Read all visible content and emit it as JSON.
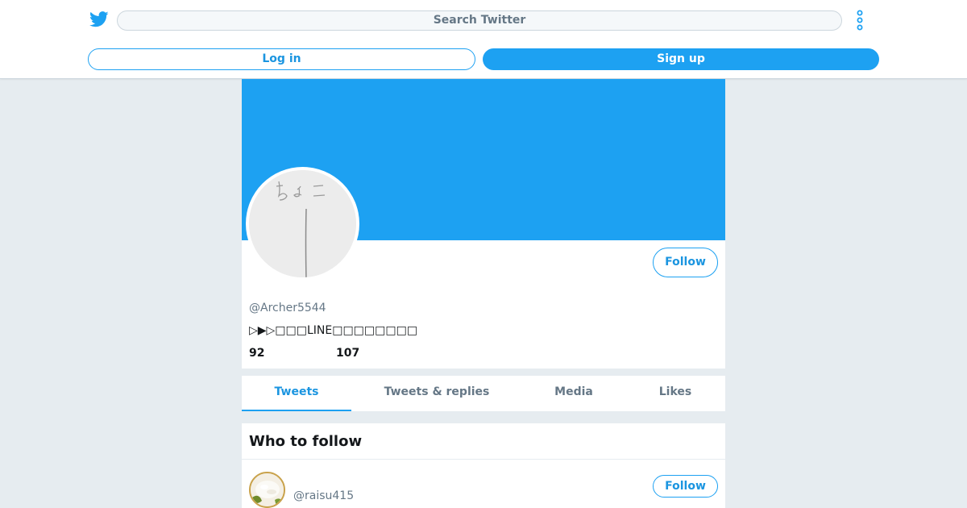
{
  "header": {
    "logo_icon": "twitter-bird-icon",
    "search_placeholder": "Search Twitter",
    "more_icon": "more-vertical-icon",
    "login_label": "Log in",
    "signup_label": "Sign up"
  },
  "profile": {
    "handle": "@Archer5544",
    "bio": "▷▶▷□□□LINE□□□□□□□□",
    "following_count": "92",
    "followers_count": "107",
    "follow_label": "Follow",
    "banner_color": "#1da1f2"
  },
  "tabs": [
    {
      "label": "Tweets",
      "active": true
    },
    {
      "label": "Tweets & replies",
      "active": false
    },
    {
      "label": "Media",
      "active": false
    },
    {
      "label": "Likes",
      "active": false
    }
  ],
  "who_to_follow": {
    "title": "Who to follow",
    "items": [
      {
        "handle": "@raisu415",
        "follow_label": "Follow"
      }
    ]
  },
  "colors": {
    "accent": "#1da1f2",
    "accent_text": "#1b95e0",
    "background": "#e6ecf0",
    "muted_text": "#657786"
  }
}
